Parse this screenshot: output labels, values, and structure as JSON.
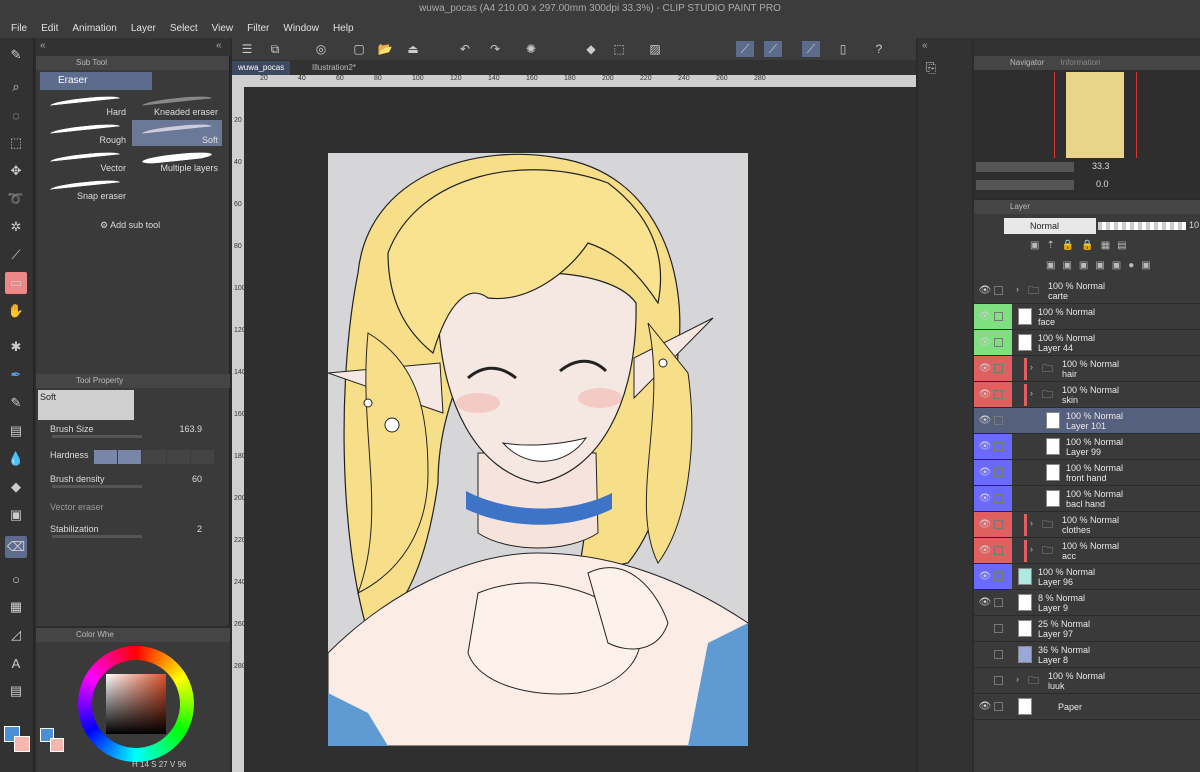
{
  "title_bar": {
    "text": "wuwa_pocas (A4 210.00 x 297.00mm 300dpi 33.3%) - CLIP STUDIO PAINT PRO"
  },
  "menu": [
    "File",
    "Edit",
    "Animation",
    "Layer",
    "Select",
    "View",
    "Filter",
    "Window",
    "Help"
  ],
  "sub_tool": {
    "tab_label": "Sub Tool",
    "group": "Eraser",
    "brushes": [
      {
        "label": "Hard"
      },
      {
        "label": "Kneaded eraser"
      },
      {
        "label": "Rough"
      },
      {
        "label": "Soft"
      },
      {
        "label": "Vector"
      },
      {
        "label": "Multiple layers"
      },
      {
        "label": "Snap eraser"
      }
    ],
    "add_label": "Add sub tool"
  },
  "tool_property": {
    "tab_label": "Tool Property",
    "preset": "Soft",
    "brush_size_label": "Brush Size",
    "brush_size_value": "163.9",
    "hardness_label": "Hardness",
    "brush_density_label": "Brush density",
    "brush_density_value": "60",
    "vector_eraser_label": "Vector eraser",
    "stabilization_label": "Stabilization",
    "stabilization_value": "2"
  },
  "color": {
    "tab_label": "Color Whe",
    "main": "#4a8fd8",
    "sub": "#f4b8b0",
    "readout": {
      "h_label": "H",
      "h": "14",
      "s_label": "S",
      "s": "27",
      "v_label": "V",
      "v": "96"
    }
  },
  "doc_tabs": [
    {
      "label": "wuwa_pocas",
      "active": true
    },
    {
      "label": "Illustration2*",
      "active": false
    }
  ],
  "ruler_h": [
    "20",
    "40",
    "60",
    "80",
    "100",
    "120",
    "140",
    "160",
    "180",
    "200",
    "220",
    "240",
    "260",
    "280"
  ],
  "ruler_v": [
    "20",
    "40",
    "60",
    "80",
    "100",
    "120",
    "140",
    "160",
    "180",
    "200",
    "220",
    "240",
    "260",
    "280"
  ],
  "navigator": {
    "tab_label": "Navigator",
    "tab2_label": "Information",
    "zoom": "33.3",
    "rotation": "0.0"
  },
  "layer_panel": {
    "tab_label": "Layer",
    "blend_mode": "Normal",
    "opacity_value": "10",
    "layers": [
      {
        "opacity": "100 %",
        "mode": "Normal",
        "name": "carte",
        "type": "folder",
        "indent": 0,
        "visible": true,
        "color": ""
      },
      {
        "opacity": "100 %",
        "mode": "Normal",
        "name": "face",
        "type": "raster",
        "indent": 0,
        "visible": true,
        "color": "#7fe07f"
      },
      {
        "opacity": "100 %",
        "mode": "Normal",
        "name": "Layer 44",
        "type": "raster",
        "indent": 0,
        "visible": true,
        "color": "#7fe07f"
      },
      {
        "opacity": "100 %",
        "mode": "Normal",
        "name": "hair",
        "type": "folder",
        "indent": 1,
        "visible": true,
        "color": "#e06060"
      },
      {
        "opacity": "100 %",
        "mode": "Normal",
        "name": "skin",
        "type": "folder",
        "indent": 1,
        "visible": true,
        "color": "#e06060"
      },
      {
        "opacity": "100 %",
        "mode": "Normal",
        "name": "Layer 101",
        "type": "raster",
        "indent": 2,
        "visible": true,
        "color": "",
        "selected": true
      },
      {
        "opacity": "100 %",
        "mode": "Normal",
        "name": "Layer 99",
        "type": "raster",
        "indent": 2,
        "visible": true,
        "color": "#6a6aff"
      },
      {
        "opacity": "100 %",
        "mode": "Normal",
        "name": "front hand",
        "type": "raster",
        "indent": 2,
        "visible": true,
        "color": "#6a6aff"
      },
      {
        "opacity": "100 %",
        "mode": "Normal",
        "name": "bacl hand",
        "type": "raster",
        "indent": 2,
        "visible": true,
        "color": "#6a6aff"
      },
      {
        "opacity": "100 %",
        "mode": "Normal",
        "name": "clothes",
        "type": "folder",
        "indent": 1,
        "visible": true,
        "color": "#e06060"
      },
      {
        "opacity": "100 %",
        "mode": "Normal",
        "name": "acc",
        "type": "folder",
        "indent": 1,
        "visible": true,
        "color": "#e06060"
      },
      {
        "opacity": "100 %",
        "mode": "Normal",
        "name": "Layer 96",
        "type": "raster",
        "indent": 0,
        "visible": true,
        "color": "#6a6aff"
      },
      {
        "opacity": "8 %",
        "mode": "Normal",
        "name": "Layer 9",
        "type": "raster",
        "indent": 0,
        "visible": true,
        "color": ""
      },
      {
        "opacity": "25 %",
        "mode": "Normal",
        "name": "Layer 97",
        "type": "raster",
        "indent": 0,
        "visible": false,
        "color": ""
      },
      {
        "opacity": "36 %",
        "mode": "Normal",
        "name": "Layer 8",
        "type": "raster",
        "indent": 0,
        "visible": false,
        "color": ""
      },
      {
        "opacity": "100 %",
        "mode": "Normal",
        "name": "luuk",
        "type": "folder",
        "indent": 0,
        "visible": false,
        "color": ""
      },
      {
        "opacity": "",
        "mode": "",
        "name": "Paper",
        "type": "paper",
        "indent": 0,
        "visible": true,
        "color": ""
      }
    ]
  }
}
